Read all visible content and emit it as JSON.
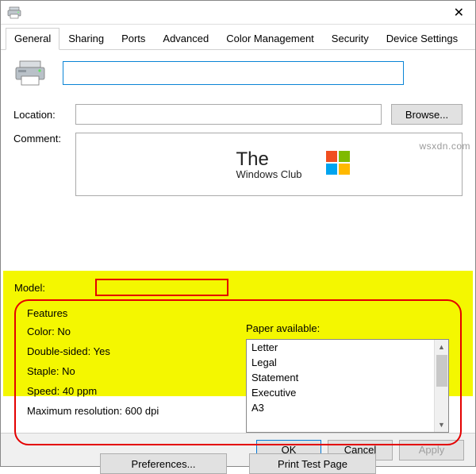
{
  "titlebar": {
    "close": "✕"
  },
  "tabs": [
    "General",
    "Sharing",
    "Ports",
    "Advanced",
    "Color Management",
    "Security",
    "Device Settings"
  ],
  "active_tab": 0,
  "labels": {
    "location": "Location:",
    "comment": "Comment:",
    "browse": "Browse...",
    "model": "Model:"
  },
  "brand": {
    "line1": "The",
    "line2": "Windows Club"
  },
  "features": {
    "title": "Features",
    "color_label": "Color:",
    "color_value": "No",
    "double_label": "Double-sided:",
    "double_value": "Yes",
    "staple_label": "Staple:",
    "staple_value": "No",
    "speed_label": "Speed:",
    "speed_value": "40 ppm",
    "res_label": "Maximum resolution:",
    "res_value": "600 dpi",
    "paper_label": "Paper available:",
    "paper_list": [
      "Letter",
      "Legal",
      "Statement",
      "Executive",
      "A3"
    ]
  },
  "feature_buttons": {
    "prefs": "Preferences...",
    "test": "Print Test Page"
  },
  "footer": {
    "ok": "OK",
    "cancel": "Cancel",
    "apply": "Apply"
  },
  "watermark": "wsxdn.com"
}
